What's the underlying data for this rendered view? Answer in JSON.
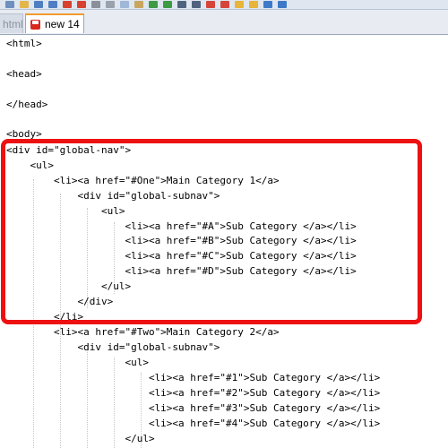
{
  "tabs": [
    {
      "label": "html",
      "active": false
    },
    {
      "label": "new  14",
      "active": true
    }
  ],
  "toolbar": {
    "icons": [
      "new-file-icon",
      "open-file-icon",
      "save-icon",
      "save-all-icon",
      "close-icon",
      "close-all-icon",
      "print-icon",
      "cut-icon",
      "copy-icon",
      "paste-icon",
      "undo-icon",
      "redo-icon",
      "find-icon",
      "replace-icon",
      "zoom-in-icon",
      "zoom-out-icon",
      "sync-v-icon",
      "sync-h-icon",
      "wrap-icon",
      "indent-guide-icon"
    ]
  },
  "code_lines": [
    "<html>",
    "",
    "<head>",
    "",
    "</head>",
    "",
    "<body>",
    "<div id=\"global-nav\">",
    "    <ul>",
    "        <li><a href=\"#One\">Main Category 1</a>",
    "            <div id=\"global-subnav\">",
    "                <ul>",
    "                    <li><a href=\"#A\">Sub Category </a></li>",
    "                    <li><a href=\"#B\">Sub Category </a></li>",
    "                    <li><a href=\"#C\">Sub Category </a></li>",
    "                    <li><a href=\"#D\">Sub Category </a></li>",
    "                </ul>",
    "            </div>",
    "        </li>",
    "        <li><a href=\"#Two\">Main Category 2</a>",
    "            <div id=\"global-subnav\">",
    "                    <ul>",
    "                        <li><a href=\"#1\">Sub Category </a></li>",
    "                        <li><a href=\"#2\">Sub Category </a></li>",
    "                        <li><a href=\"#3\">Sub Category </a></li>",
    "                        <li><a href=\"#4\">Sub Category </a></li>",
    "                    </ul>"
  ],
  "colors": {
    "highlight": "#ee1111",
    "tab_accent": "#f29a2e"
  }
}
